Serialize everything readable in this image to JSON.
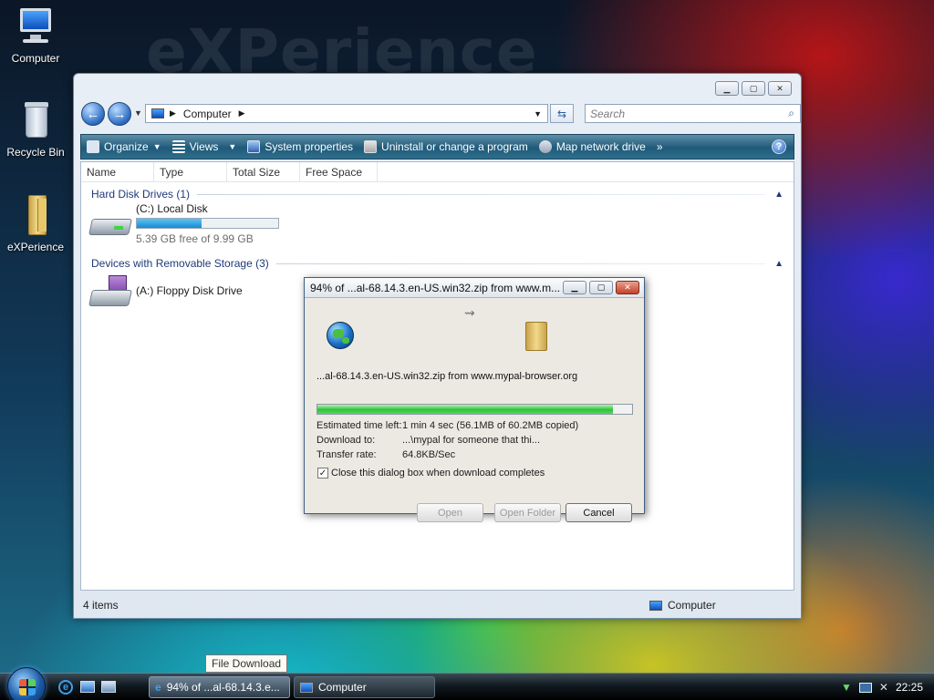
{
  "desktop": {
    "watermark": "eXPerience",
    "icons": [
      {
        "label": "Computer"
      },
      {
        "label": "Recycle Bin"
      },
      {
        "label": "eXPerience"
      }
    ]
  },
  "explorer": {
    "address": {
      "location": "Computer"
    },
    "search": {
      "placeholder": "Search"
    },
    "toolbar": {
      "organize": "Organize",
      "views": "Views",
      "system_properties": "System properties",
      "uninstall": "Uninstall or change a program",
      "map_drive": "Map network drive",
      "more": "»"
    },
    "columns": [
      "Name",
      "Type",
      "Total Size",
      "Free Space"
    ],
    "groups": {
      "hard_disks": "Hard Disk Drives (1)",
      "removable": "Devices with Removable Storage (3)"
    },
    "drives": {
      "c_label": "(C:) Local Disk",
      "c_free": "5.39 GB free of 9.99 GB",
      "c_used_fraction": 0.46,
      "a_label": "(A:) Floppy Disk Drive"
    },
    "status": {
      "items": "4 items",
      "location": "Computer"
    }
  },
  "download_dialog": {
    "title": "94% of ...al-68.14.3.en-US.win32.zip from www.m...",
    "source": "...al-68.14.3.en-US.win32.zip from www.mypal-browser.org",
    "progress_fraction": 0.94,
    "time_left_label": "Estimated time left:",
    "time_left_value": "1 min 4 sec (56.1MB of 60.2MB copied)",
    "download_to_label": "Download to:",
    "download_to_value": "...\\mypal for someone that thi...",
    "transfer_rate_label": "Transfer rate:",
    "transfer_rate_value": "64.8KB/Sec",
    "close_checkbox": "Close this dialog box when download completes",
    "close_checked": true,
    "buttons": {
      "open": "Open",
      "open_folder": "Open Folder",
      "cancel": "Cancel"
    }
  },
  "taskbar": {
    "tooltip": "File Download",
    "tasks": [
      {
        "label": "94% of ...al-68.14.3.e..."
      },
      {
        "label": "Computer"
      }
    ],
    "clock": "22:25"
  }
}
